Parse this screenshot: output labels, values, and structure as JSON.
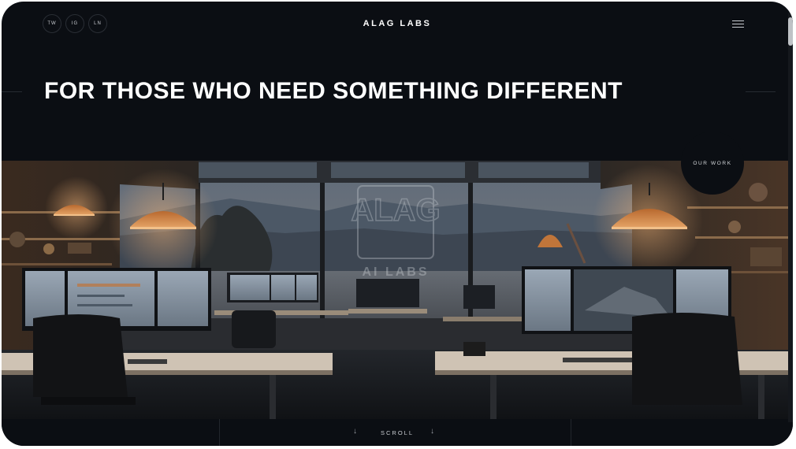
{
  "header": {
    "socials": [
      {
        "label": "TW"
      },
      {
        "label": "IG"
      },
      {
        "label": "LN"
      }
    ],
    "brand": "ALAG LABS",
    "menu_icon": "hamburger-icon"
  },
  "hero": {
    "headline": "FOR THOSE WHO NEED SOMETHING DIFFERENT",
    "our_work_label": "OUR WORK",
    "image_logo_text": "AI LABS",
    "image_logo_letters": "ALAG"
  },
  "footer": {
    "scroll_label": "SCROLL",
    "arrow_icon": "arrow-down-icon"
  },
  "colors": {
    "background": "#0b0e13",
    "text": "#ffffff",
    "lamp": "#c0753a"
  }
}
